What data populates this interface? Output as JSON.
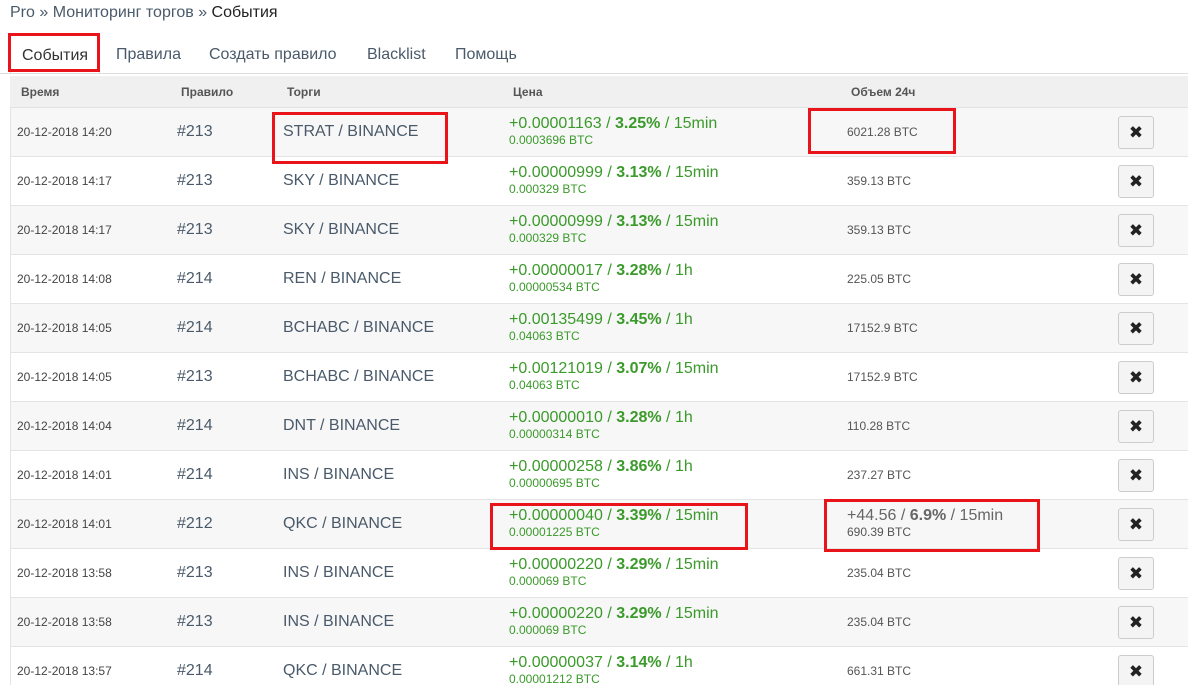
{
  "breadcrumb": {
    "root": "Pro",
    "sep1": "»",
    "section": "Мониторинг торгов",
    "sep2": "»",
    "current": "События"
  },
  "tabs": [
    {
      "label": "События"
    },
    {
      "label": "Правила"
    },
    {
      "label": "Создать правило"
    },
    {
      "label": "Blacklist"
    },
    {
      "label": "Помощь"
    }
  ],
  "table": {
    "columns": {
      "time": "Время",
      "rule": "Правило",
      "trade": "Торги",
      "price": "Цена",
      "volume": "Объем 24ч"
    },
    "delete_glyph": "✖",
    "rows": [
      {
        "time": "20-12-2018 14:20",
        "rule": "#213",
        "trade": "STRAT / BINANCE",
        "price_change": "+0.00001163",
        "sep_a": " / ",
        "percent": "3.25%",
        "sep_b": " / ",
        "interval": "15min",
        "price_btc": "0.0003696 BTC",
        "volume": "6021.28 BTC"
      },
      {
        "time": "20-12-2018 14:17",
        "rule": "#213",
        "trade": "SKY / BINANCE",
        "price_change": "+0.00000999",
        "sep_a": " / ",
        "percent": "3.13%",
        "sep_b": " / ",
        "interval": "15min",
        "price_btc": "0.000329 BTC",
        "volume": "359.13 BTC"
      },
      {
        "time": "20-12-2018 14:17",
        "rule": "#213",
        "trade": "SKY / BINANCE",
        "price_change": "+0.00000999",
        "sep_a": " / ",
        "percent": "3.13%",
        "sep_b": " / ",
        "interval": "15min",
        "price_btc": "0.000329 BTC",
        "volume": "359.13 BTC"
      },
      {
        "time": "20-12-2018 14:08",
        "rule": "#214",
        "trade": "REN / BINANCE",
        "price_change": "+0.00000017",
        "sep_a": " / ",
        "percent": "3.28%",
        "sep_b": " / ",
        "interval": "1h",
        "price_btc": "0.00000534 BTC",
        "volume": "225.05 BTC"
      },
      {
        "time": "20-12-2018 14:05",
        "rule": "#214",
        "trade": "BCHABC / BINANCE",
        "price_change": "+0.00135499",
        "sep_a": " / ",
        "percent": "3.45%",
        "sep_b": " / ",
        "interval": "1h",
        "price_btc": "0.04063 BTC",
        "volume": "17152.9 BTC"
      },
      {
        "time": "20-12-2018 14:05",
        "rule": "#213",
        "trade": "BCHABC / BINANCE",
        "price_change": "+0.00121019",
        "sep_a": " / ",
        "percent": "3.07%",
        "sep_b": " / ",
        "interval": "15min",
        "price_btc": "0.04063 BTC",
        "volume": "17152.9 BTC"
      },
      {
        "time": "20-12-2018 14:04",
        "rule": "#214",
        "trade": "DNT / BINANCE",
        "price_change": "+0.00000010",
        "sep_a": " / ",
        "percent": "3.28%",
        "sep_b": " / ",
        "interval": "1h",
        "price_btc": "0.00000314 BTC",
        "volume": "110.28 BTC"
      },
      {
        "time": "20-12-2018 14:01",
        "rule": "#214",
        "trade": "INS / BINANCE",
        "price_change": "+0.00000258",
        "sep_a": " / ",
        "percent": "3.86%",
        "sep_b": " / ",
        "interval": "1h",
        "price_btc": "0.00000695 BTC",
        "volume": "237.27 BTC"
      },
      {
        "time": "20-12-2018 14:01",
        "rule": "#212",
        "trade": "QKC / BINANCE",
        "price_change": "+0.00000040",
        "sep_a": " / ",
        "percent": "3.39%",
        "sep_b": " / ",
        "interval": "15min",
        "price_btc": "0.00001225 BTC",
        "volume_change": "+44.56",
        "vol_sep_a": " / ",
        "volume_percent": "6.9%",
        "vol_sep_b": " / ",
        "volume_interval": "15min",
        "volume": "690.39 BTC"
      },
      {
        "time": "20-12-2018 13:58",
        "rule": "#213",
        "trade": "INS / BINANCE",
        "price_change": "+0.00000220",
        "sep_a": " / ",
        "percent": "3.29%",
        "sep_b": " / ",
        "interval": "15min",
        "price_btc": "0.000069 BTC",
        "volume": "235.04 BTC"
      },
      {
        "time": "20-12-2018 13:58",
        "rule": "#213",
        "trade": "INS / BINANCE",
        "price_change": "+0.00000220",
        "sep_a": " / ",
        "percent": "3.29%",
        "sep_b": " / ",
        "interval": "15min",
        "price_btc": "0.000069 BTC",
        "volume": "235.04 BTC"
      },
      {
        "time": "20-12-2018 13:57",
        "rule": "#214",
        "trade": "QKC / BINANCE",
        "price_change": "+0.00000037",
        "sep_a": " / ",
        "percent": "3.14%",
        "sep_b": " / ",
        "interval": "1h",
        "price_btc": "0.00001212 BTC",
        "volume": "661.31 BTC"
      }
    ]
  },
  "colors": {
    "positive": "#3a9a2a",
    "highlight": "#e8141a",
    "link": "#4a5a6a"
  }
}
